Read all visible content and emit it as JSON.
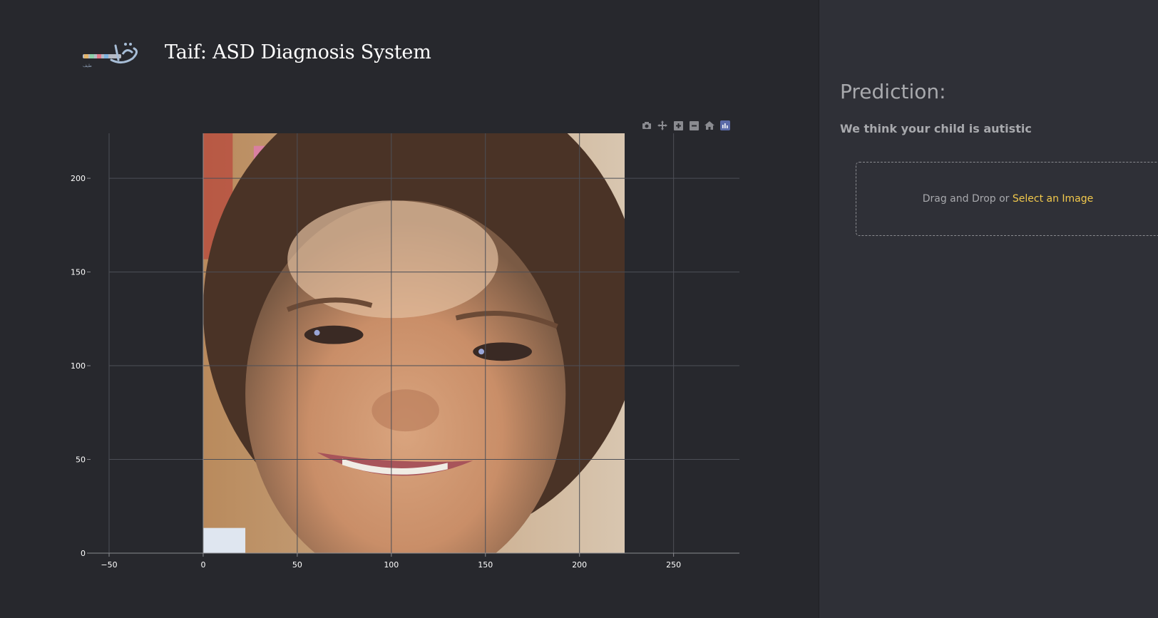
{
  "header": {
    "title": "Taif: ASD Diagnosis System",
    "logo_text": "طيف"
  },
  "modebar": {
    "buttons": [
      "camera-icon",
      "pan-icon",
      "zoom-in-icon",
      "zoom-out-icon",
      "home-icon",
      "plotly-logo-icon"
    ]
  },
  "chart_data": {
    "type": "image",
    "x_ticks": [
      "−50",
      "0",
      "50",
      "100",
      "150",
      "200",
      "250"
    ],
    "y_ticks": [
      "0",
      "50",
      "100",
      "150",
      "200"
    ],
    "x_tick_values": [
      -50,
      0,
      50,
      100,
      150,
      200,
      250
    ],
    "y_tick_values": [
      0,
      50,
      100,
      150,
      200
    ],
    "xlim": [
      -50,
      285
    ],
    "ylim": [
      0,
      224
    ],
    "image_extent": {
      "x": [
        0,
        224
      ],
      "y": [
        0,
        224
      ]
    },
    "grid": true
  },
  "prediction": {
    "title": "Prediction:",
    "text": "We think your child is autistic"
  },
  "upload": {
    "prefix": "Drag and Drop or ",
    "link": "Select an Image"
  },
  "colors": {
    "accent": "#f2c94c",
    "panel_left": "#27282d",
    "panel_right": "#2f3037",
    "text_muted": "#a8a9ad"
  }
}
